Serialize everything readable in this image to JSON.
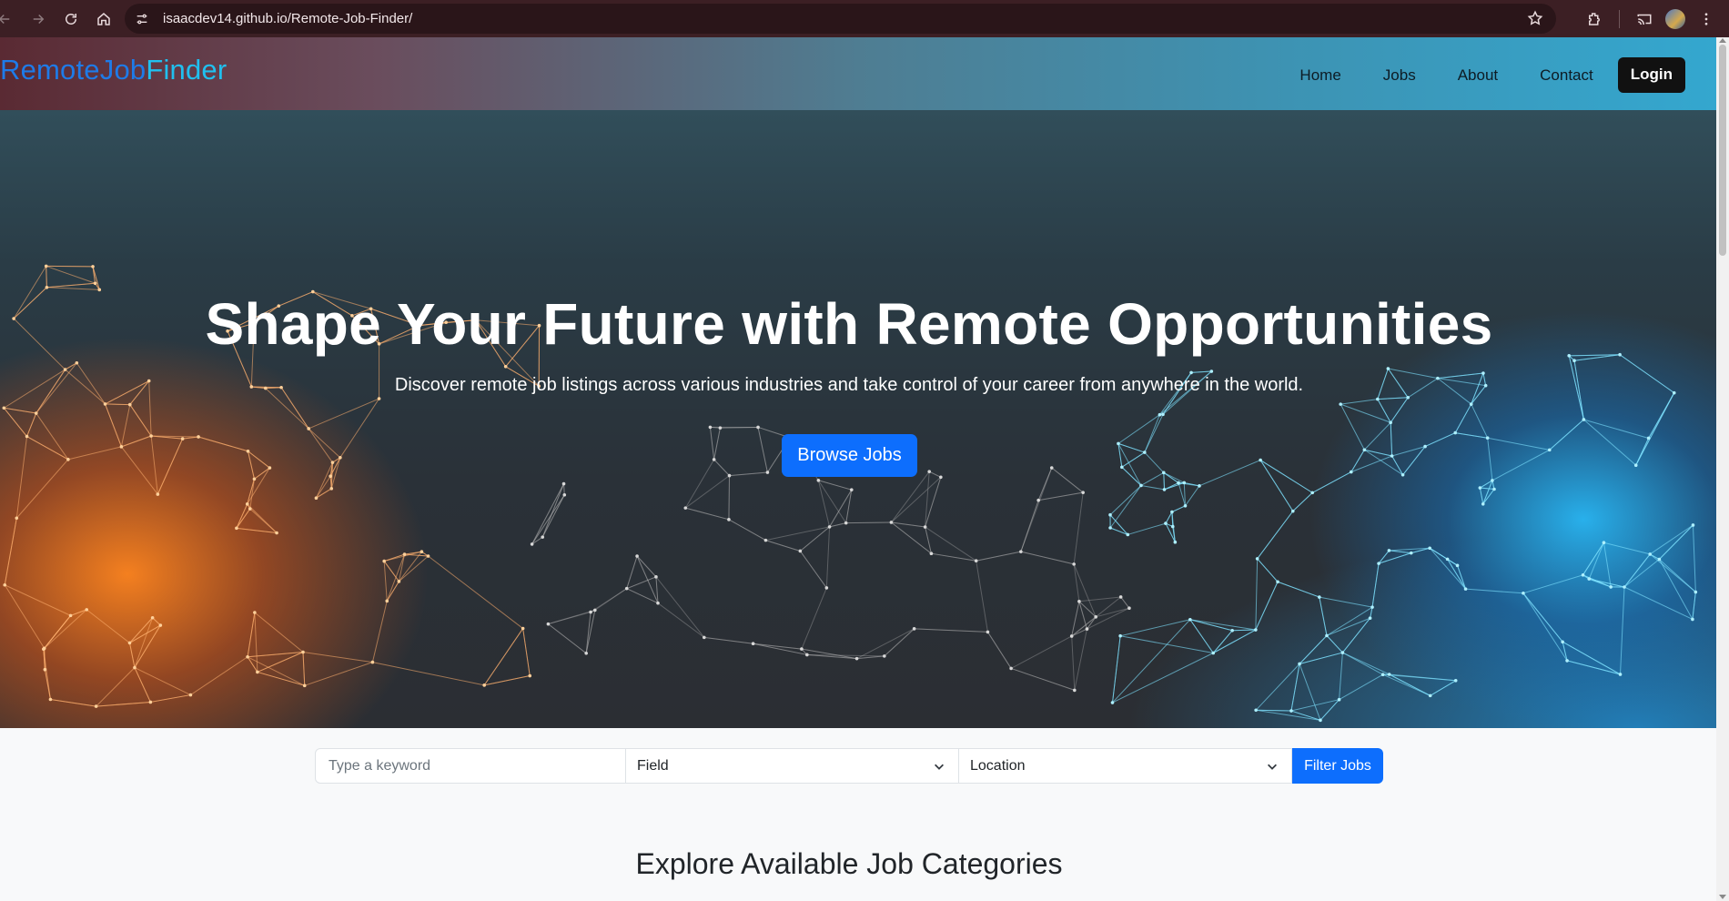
{
  "browser": {
    "url": "isaacdev14.github.io/Remote-Job-Finder/"
  },
  "navbar": {
    "brand_part1": "RemoteJob",
    "brand_part2": "Finder",
    "links": [
      "Home",
      "Jobs",
      "About",
      "Contact"
    ],
    "login_label": "Login"
  },
  "hero": {
    "title": "Shape Your Future with Remote Opportunities",
    "subtitle": "Discover remote job listings across various industries and take control of your career from anywhere in the world.",
    "cta_label": "Browse Jobs"
  },
  "filter": {
    "keyword_placeholder": "Type a keyword",
    "field_value": "Field",
    "location_value": "Location",
    "button_label": "Filter Jobs"
  },
  "categories": {
    "title": "Explore Available Job Categories"
  },
  "colors": {
    "primary": "#0d6efd",
    "brand_blue": "#1e7be8",
    "brand_cyan": "#20c0ef",
    "login_bg": "#111111",
    "hero_orange": "#ff8420",
    "hero_blue": "#28beff"
  },
  "icons": [
    "back-icon",
    "forward-icon",
    "reload-icon",
    "home-icon",
    "site-info-icon",
    "star-icon",
    "extensions-icon",
    "cast-icon",
    "profile-avatar",
    "menu-icon",
    "chevron-down-icon"
  ]
}
